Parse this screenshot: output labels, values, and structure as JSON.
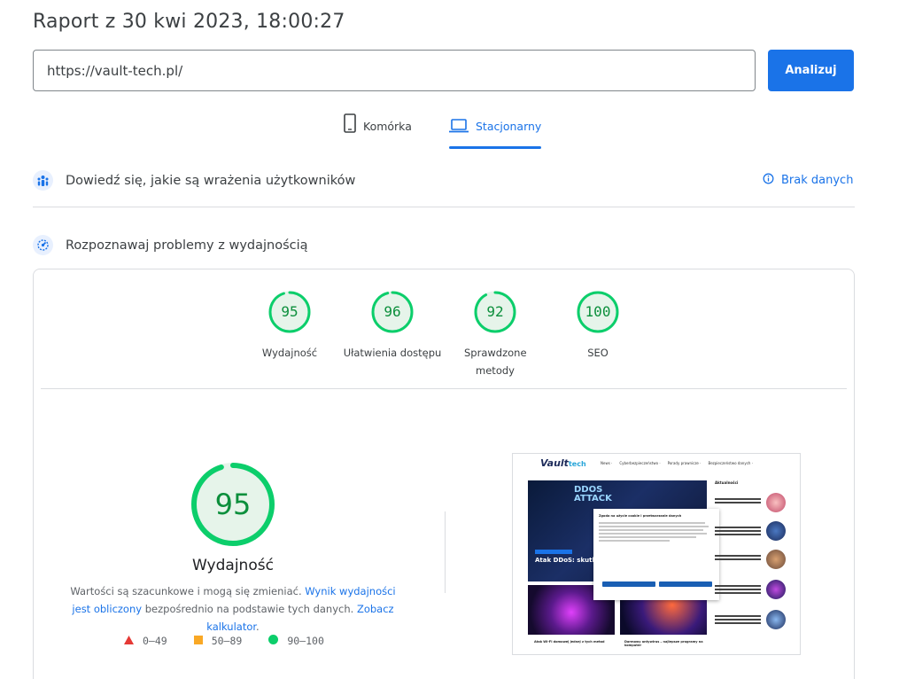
{
  "report": {
    "title": "Raport z 30 kwi 2023, 18:00:27"
  },
  "search": {
    "url_value": "https://vault-tech.pl/",
    "analyze_label": "Analizuj"
  },
  "tabs": [
    {
      "label": "Komórka",
      "icon": "smartphone-icon",
      "active": false
    },
    {
      "label": "Stacjonarny",
      "icon": "laptop-icon",
      "active": true
    }
  ],
  "field_data": {
    "title": "Dowiedź się, jakie są wrażenia użytkowników",
    "no_data_label": "Brak danych",
    "icon": "users-icon"
  },
  "lab_data": {
    "title": "Rozpoznawaj problemy z wydajnością",
    "icon": "gauge-icon"
  },
  "categories": [
    {
      "score": "95",
      "label": "Wydajność",
      "value": 95
    },
    {
      "score": "96",
      "label": "Ułatwienia dostępu",
      "value": 96
    },
    {
      "score": "92",
      "label": "Sprawdzone metody",
      "value": 92
    },
    {
      "score": "100",
      "label": "SEO",
      "value": 100
    }
  ],
  "performance": {
    "score": "95",
    "value": 95,
    "label": "Wydajność",
    "note_prefix": "Wartości są szacunkowe i mogą się zmieniać. ",
    "note_link1": "Wynik wydajności jest obliczony",
    "note_middle": " bezpośrednio na podstawie tych danych. ",
    "note_link2": "Zobacz kalkulator",
    "note_suffix": "."
  },
  "legend": [
    {
      "range": "0–49",
      "shape": "triangle",
      "color": "#e53935"
    },
    {
      "range": "50–89",
      "shape": "square",
      "color": "#f9a825"
    },
    {
      "range": "90–100",
      "shape": "circle",
      "color": "#0cce6b"
    }
  ],
  "screenshot": {
    "logo": "Vault",
    "logo_suffix": "tech",
    "menu": [
      "News ·",
      "Cyberbezpieczeństwo ·",
      "Porady prawnicze ·",
      "Bezpieczeństwo danych ·"
    ],
    "hero_text_line1": "DDOS",
    "hero_text_line2": "ATTACK",
    "hero_title": "Atak DDoS: skutki i",
    "modal_title": "Zgoda na użycie cookie i przetwarzanie danych",
    "sidebar_title": "Aktualności",
    "card2_caption": "Atak Wi-Fi domowej jednej z tych metod",
    "card3_caption": "Darmowy antywirus – najlepsze programy na komputer"
  },
  "colors": {
    "accent": "#1a73e8",
    "pass": "#0cce6b",
    "pass_text": "#0c8f3c"
  }
}
